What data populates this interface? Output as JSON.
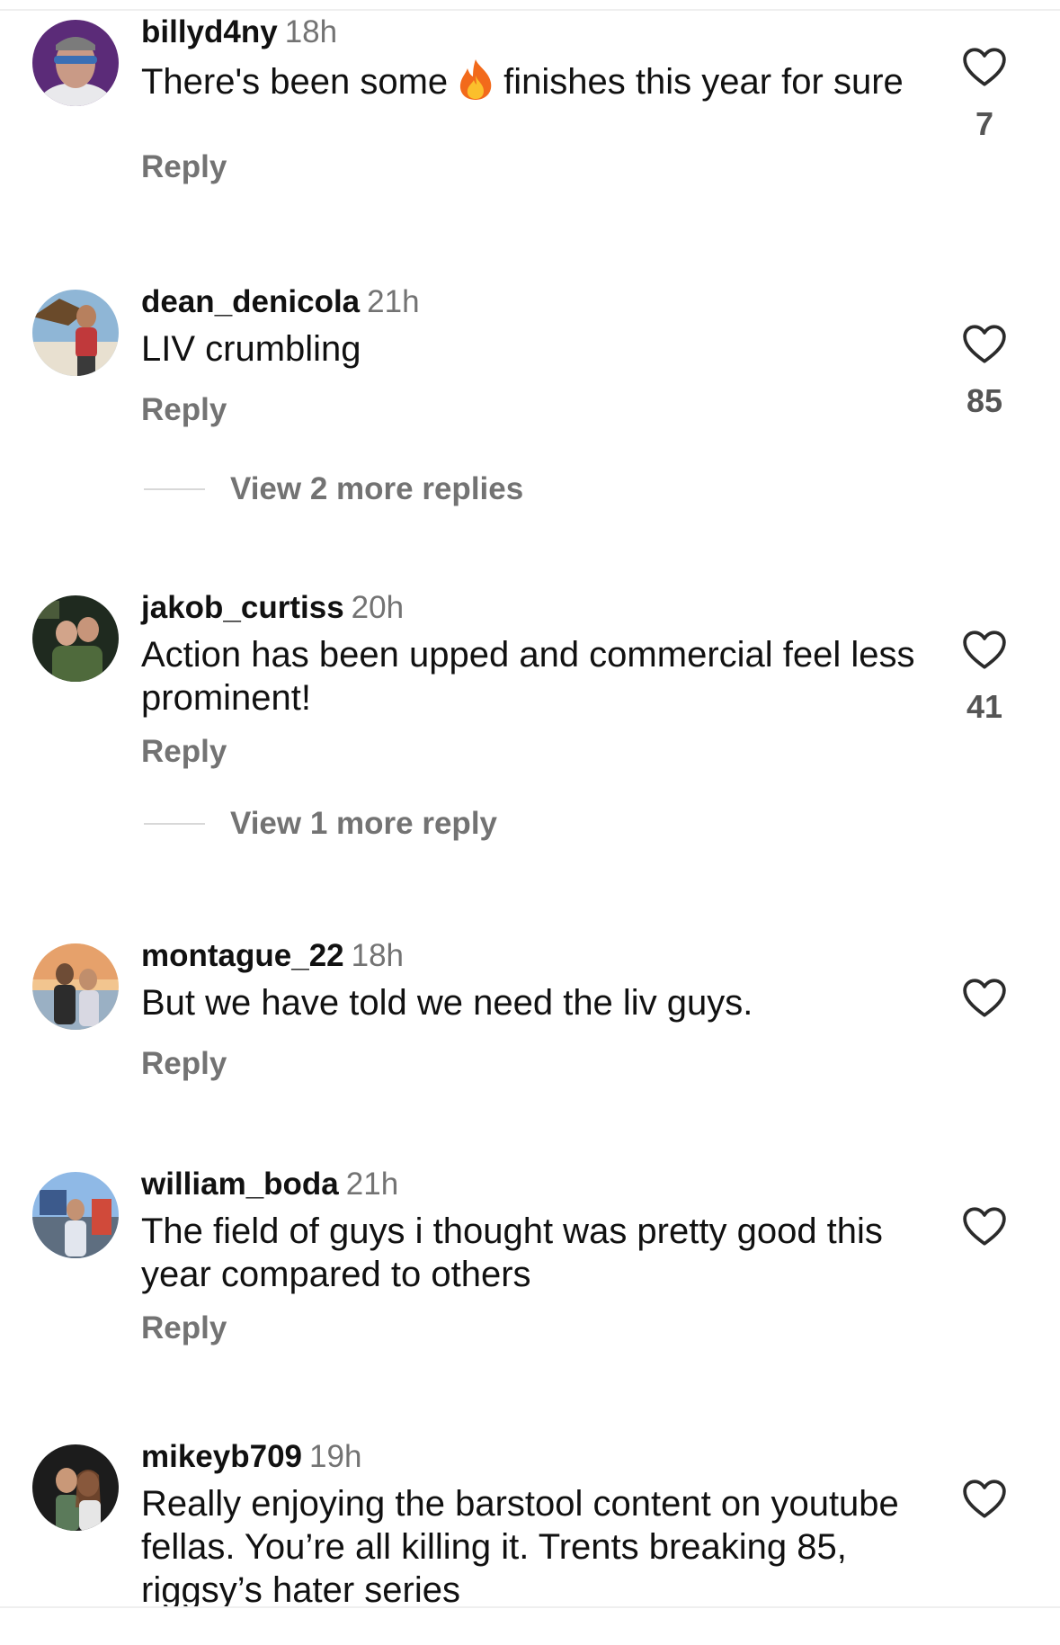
{
  "comments": [
    {
      "username": "billyd4ny",
      "time": "18h",
      "text_before": "There's been some",
      "emoji": "fire-emoji",
      "text_after": "finishes this year for sure",
      "reply": "Reply",
      "likes": "7"
    },
    {
      "username": "dean_denicola",
      "time": "21h",
      "text": "LIV crumbling",
      "reply": "Reply",
      "likes": "85",
      "view_replies": "View 2 more replies"
    },
    {
      "username": "jakob_curtiss",
      "time": "20h",
      "text": "Action has been upped and commercial feel less prominent!",
      "reply": "Reply",
      "likes": "41",
      "view_replies": "View 1 more reply"
    },
    {
      "username": "montague_22",
      "time": "18h",
      "text": "But we have told we need the liv guys.",
      "reply": "Reply"
    },
    {
      "username": "william_boda",
      "time": "21h",
      "text": "The field of guys i thought was pretty good this year compared to others",
      "reply": "Reply"
    },
    {
      "username": "mikeyb709",
      "time": "19h",
      "text": "Really enjoying the barstool content on youtube fellas. You’re all killing it. Trents breaking 85, riggsy’s hater series"
    }
  ],
  "icons": {
    "like": "heart-outline-icon",
    "avatar": "user-avatar"
  },
  "colors": {
    "text": "#111111",
    "muted": "#737373",
    "like_count": "#555555",
    "divider": "#efefef"
  }
}
